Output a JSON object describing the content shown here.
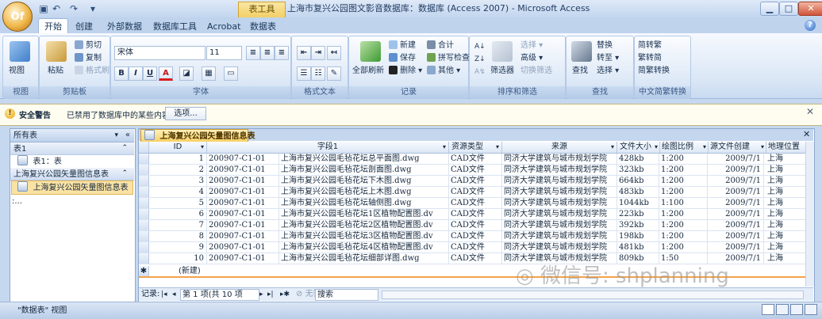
{
  "window": {
    "title": "上海市复兴公园图文影音数据库：数据库 (Access 2007) - Microsoft Access",
    "context_tab": "表工具",
    "minimize": "▁",
    "maximize": "□",
    "close": "✕"
  },
  "office_button": "Of",
  "tabs": [
    "开始",
    "创建",
    "外部数据",
    "数据库工具",
    "Acrobat",
    "数据表"
  ],
  "ribbon": {
    "view": {
      "view_label": "视图",
      "group_label": "视图"
    },
    "clipboard": {
      "paste_label": "粘贴",
      "cut": "剪切",
      "copy": "复制",
      "format_painter": "格式刷",
      "group_label": "剪贴板"
    },
    "font": {
      "font_name": "宋体",
      "font_size": "11",
      "bold": "B",
      "italic": "I",
      "underline": "U",
      "font_color": "A",
      "group_label": "字体"
    },
    "rich_text": {
      "group_label": "格式文本"
    },
    "records": {
      "refresh": "全部刷新",
      "new": "新建",
      "save": "保存",
      "delete": "删除",
      "totals": "合计",
      "spelling": "拼写检查",
      "more": "其他",
      "group_label": "记录"
    },
    "sort_filter": {
      "filter": "筛选器",
      "selection": "选择",
      "advanced": "高级",
      "toggle_filter": "切换筛选",
      "group_label": "排序和筛选"
    },
    "find": {
      "find": "查找",
      "replace": "替换",
      "goto": "转至",
      "select": "选择",
      "group_label": "查找"
    },
    "chinese_conversion": {
      "to_traditional": "简转繁",
      "to_simplified": "繁转简",
      "convert": "简繁转换",
      "group_label": "中文简繁转换"
    }
  },
  "message_bar": {
    "title": "安全警告",
    "text": "已禁用了数据库中的某些内容",
    "options_button": "选项..."
  },
  "nav_pane": {
    "header": "所有表",
    "groups": [
      {
        "label": "表1",
        "items": [
          "表1：表"
        ]
      },
      {
        "label": "上海复兴公园矢量图信息表",
        "items": [
          "上海复兴公园矢量图信息表 :..."
        ]
      }
    ]
  },
  "document": {
    "tab_label": "上海复兴公园矢量图信息表",
    "columns": [
      "ID",
      "字段1",
      "资源类型",
      "来源",
      "文件大小",
      "绘图比例",
      "源文件创建",
      "地理位置"
    ],
    "rows": [
      [
        "1",
        "200907-C1-01",
        "上海市复兴公园毛毡花坛总平面图.dwg",
        "CAD文件",
        "同济大学建筑与城市规划学院",
        "428kb",
        "1:200",
        "2009/7/1",
        "上海"
      ],
      [
        "2",
        "200907-C1-01",
        "上海市复兴公园毛毡花坛剖面图.dwg",
        "CAD文件",
        "同济大学建筑与城市规划学院",
        "323kb",
        "1:200",
        "2009/7/1",
        "上海"
      ],
      [
        "3",
        "200907-C1-01",
        "上海市复兴公园毛毡花坛下木图.dwg",
        "CAD文件",
        "同济大学建筑与城市规划学院",
        "664kb",
        "1:200",
        "2009/7/1",
        "上海"
      ],
      [
        "4",
        "200907-C1-01",
        "上海市复兴公园毛毡花坛上木图.dwg",
        "CAD文件",
        "同济大学建筑与城市规划学院",
        "483kb",
        "1:200",
        "2009/7/1",
        "上海"
      ],
      [
        "5",
        "200907-C1-01",
        "上海市复兴公园毛毡花坛轴侧图.dwg",
        "CAD文件",
        "同济大学建筑与城市规划学院",
        "1044kb",
        "1:100",
        "2009/7/1",
        "上海"
      ],
      [
        "6",
        "200907-C1-01",
        "上海市复兴公园毛毡花坛1区植物配置图.dv",
        "CAD文件",
        "同济大学建筑与城市规划学院",
        "223kb",
        "1:200",
        "2009/7/1",
        "上海"
      ],
      [
        "7",
        "200907-C1-01",
        "上海市复兴公园毛毡花坛2区植物配置图.dv",
        "CAD文件",
        "同济大学建筑与城市规划学院",
        "392kb",
        "1:200",
        "2009/7/1",
        "上海"
      ],
      [
        "8",
        "200907-C1-01",
        "上海市复兴公园毛毡花坛3区植物配置图.dv",
        "CAD文件",
        "同济大学建筑与城市规划学院",
        "198kb",
        "1:200",
        "2009/7/1",
        "上海"
      ],
      [
        "9",
        "200907-C1-01",
        "上海市复兴公园毛毡花坛4区植物配置图.dv",
        "CAD文件",
        "同济大学建筑与城市规划学院",
        "481kb",
        "1:200",
        "2009/7/1",
        "上海"
      ],
      [
        "10",
        "200907-C1-01",
        "上海市复兴公园毛毡花坛细部详图.dwg",
        "CAD文件",
        "同济大学建筑与城市规划学院",
        "809kb",
        "1:50",
        "2009/7/1",
        "上海"
      ]
    ],
    "new_row_label": "(新建)",
    "new_row_marker": "✱"
  },
  "record_nav": {
    "label": "记录:",
    "position": "第 1 项(共 10 项",
    "filter": "无筛选器",
    "search": "搜索"
  },
  "status": {
    "text": "\"数据表\" 视图"
  },
  "watermark": "微信号: shplanning",
  "colors": {
    "ribbon_bg": "#dbe7f6",
    "accent": "#f7cf60",
    "frame": "#c6d8ef"
  }
}
